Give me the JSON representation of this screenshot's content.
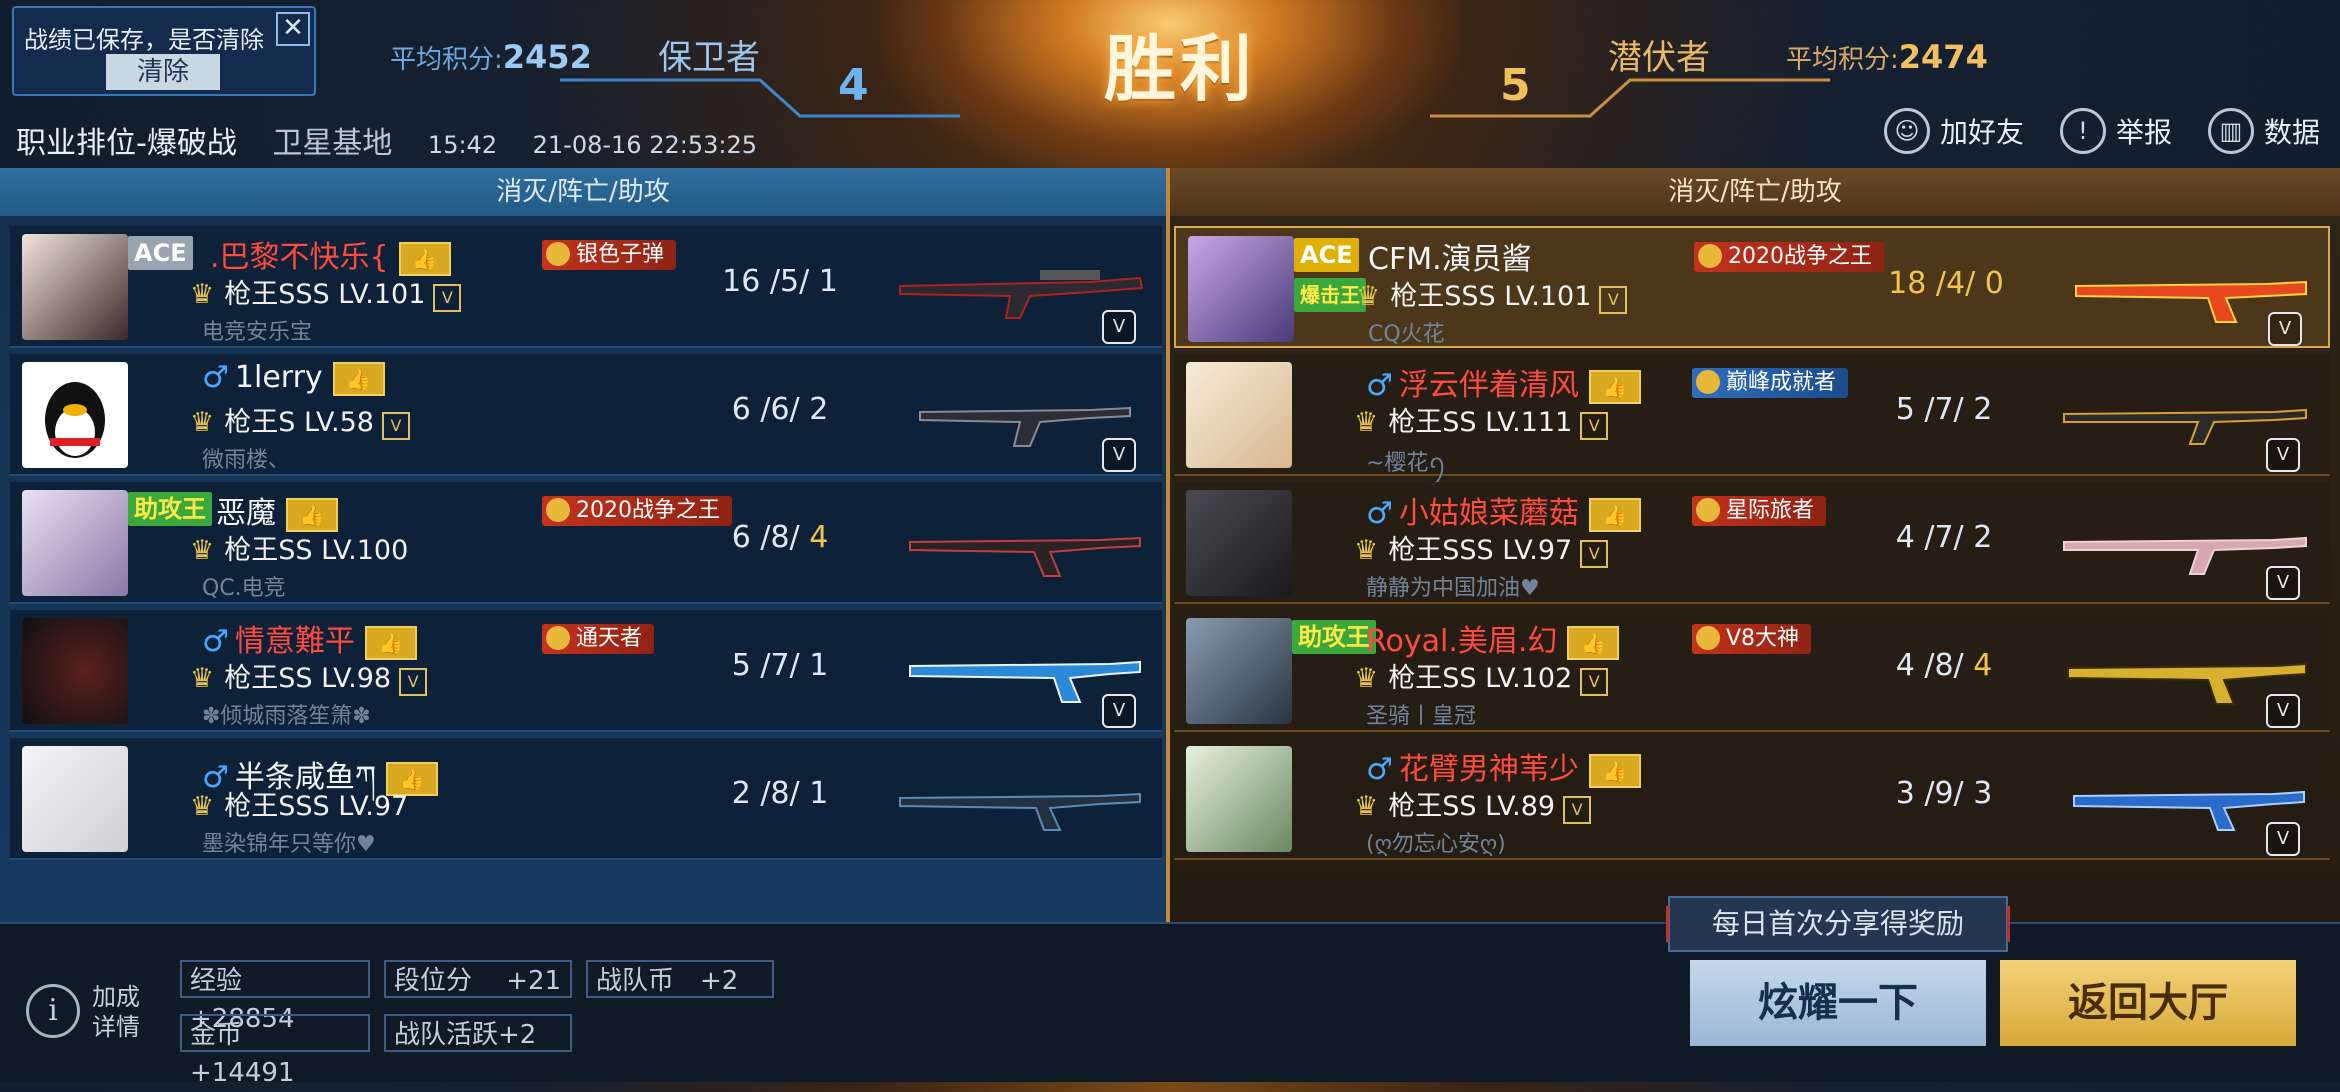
{
  "header": {
    "victory_text": "胜利",
    "notice": {
      "message": "战绩已保存，是否清除",
      "clear_label": "清除"
    },
    "left_team": {
      "avg_label": "平均积分:",
      "avg_score": "2452",
      "name": "保卫者",
      "score": "4"
    },
    "right_team": {
      "avg_label": "平均积分:",
      "avg_score": "2474",
      "name": "潜伏者",
      "score": "5"
    },
    "match": {
      "mode": "职业排位-爆破战",
      "map": "卫星基地",
      "duration": "15:42",
      "datetime": "21-08-16 22:53:25"
    },
    "actions": [
      {
        "label": "加好友",
        "icon": "add-friend-icon"
      },
      {
        "label": "举报",
        "icon": "warning-icon"
      },
      {
        "label": "数据",
        "icon": "stats-icon"
      }
    ]
  },
  "columns": {
    "left": "消灭/阵亡/助攻",
    "right": "消灭/阵亡/助攻"
  },
  "left_players": [
    {
      "tag": "ACE",
      "name": ".巴黎不快乐{",
      "rank": "枪王SSS LV.101",
      "clan": "电竞安乐宝",
      "title": "银色子弹",
      "k": "16",
      "d": "5",
      "a": "1"
    },
    {
      "tag": "",
      "name": "1lerry",
      "rank": "枪王S LV.58",
      "clan": "微雨楼、",
      "title": "",
      "k": "6",
      "d": "6",
      "a": "2"
    },
    {
      "tag": "助攻王",
      "name": "恶魔",
      "rank": "枪王SS LV.100",
      "clan": "QC.电竞",
      "title": "2020战争之王",
      "k": "6",
      "d": "8",
      "a": "4"
    },
    {
      "tag": "",
      "name": "情意難平",
      "rank": "枪王SS LV.98",
      "clan": "✽倾城雨落笙箫✽",
      "title": "通天者",
      "k": "5",
      "d": "7",
      "a": "1"
    },
    {
      "tag": "",
      "name": "半条咸鱼ཀ",
      "rank": "枪王SSS LV.97",
      "clan": "墨染锦年只等你♥",
      "title": "",
      "k": "2",
      "d": "8",
      "a": "1"
    }
  ],
  "right_players": [
    {
      "tag": "ACE",
      "tag2": "爆击王",
      "name": "CFM.演员酱",
      "rank": "枪王SSS LV.101",
      "clan": "CQ火花",
      "title": "2020战争之王",
      "k": "18",
      "d": "4",
      "a": "0"
    },
    {
      "tag": "",
      "name": "浮云伴着清风",
      "rank": "枪王SS LV.111",
      "clan": "~樱花ꪆ",
      "title": "巅峰成就者",
      "k": "5",
      "d": "7",
      "a": "2"
    },
    {
      "tag": "",
      "name": "小姑娘菜蘑菇",
      "rank": "枪王SSS LV.97",
      "clan": "静静为中国加油♥",
      "title": "星际旅者",
      "k": "4",
      "d": "7",
      "a": "2"
    },
    {
      "tag": "助攻王",
      "name": "Royal.美眉.幻",
      "rank": "枪王SS LV.102",
      "clan": "圣骑丨皇冠",
      "title": "V8大神",
      "k": "4",
      "d": "8",
      "a": "4"
    },
    {
      "tag": "",
      "name": "花臂男神苇少",
      "rank": "枪王SS LV.89",
      "clan": "(ღ勿忘心安ღ)",
      "title": "",
      "k": "3",
      "d": "9",
      "a": "3"
    }
  ],
  "rewards": {
    "bonus_label": "加成详情",
    "exp": "经验　+28854",
    "gold": "金币　+14491",
    "rank_pts": "段位分　 +21",
    "team_act": "战队活跃+2",
    "team_coin": "战队币　+2"
  },
  "share_tip": "每日首次分享得奖励",
  "buttons": {
    "share": "炫耀一下",
    "lobby": "返回大厅"
  },
  "colors": {
    "left_accent": "#2f6e9e",
    "right_accent": "#c08a3a",
    "name_red": "#ff4b3e"
  }
}
